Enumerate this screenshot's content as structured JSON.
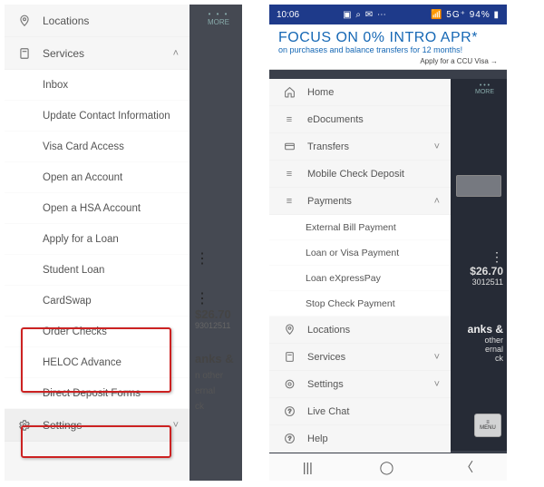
{
  "left": {
    "more_label": "MORE",
    "locations": "Locations",
    "services": "Services",
    "settings": "Settings",
    "services_items": {
      "inbox": "Inbox",
      "update_contact": "Update Contact Information",
      "visa_access": "Visa Card Access",
      "open_account": "Open an Account",
      "open_hsa": "Open a HSA Account",
      "apply_loan": "Apply for a Loan",
      "student_loan": "Student Loan",
      "cardswap": "CardSwap",
      "order_checks": "Order Checks",
      "heloc": "HELOC Advance",
      "direct_deposit": "Direct Deposit Forms"
    },
    "behind": {
      "amount": "$26.70",
      "subid": "93012511",
      "section_title": "anks &",
      "line1": "n other",
      "line2": "ernal",
      "line3": "ck"
    }
  },
  "right": {
    "status": {
      "time": "10:06",
      "left_icons": "▣ ⌕ ✉ ⋯",
      "right_icons": "📶 5G⁺ 94% ▮"
    },
    "banner": {
      "line1": "FOCUS ON 0% INTRO APR*",
      "line2": "on purchases and balance transfers for 12 months!",
      "line3": "Apply for a CCU Visa →"
    },
    "more_label": "MORE",
    "menu": {
      "home": "Home",
      "edocs": "eDocuments",
      "transfers": "Transfers",
      "mobile_deposit": "Mobile Check Deposit",
      "payments": "Payments",
      "payments_items": {
        "ext_bill": "External Bill Payment",
        "loan_visa": "Loan or Visa Payment",
        "loan_express": "Loan eXpressPay",
        "stop_check": "Stop Check Payment"
      },
      "locations": "Locations",
      "services": "Services",
      "settings": "Settings",
      "live_chat": "Live Chat",
      "help": "Help"
    },
    "behind": {
      "amount": "$26.70",
      "subid": "3012511",
      "section_title": "anks &",
      "line1": "other",
      "line2": "ernal",
      "line3": "ck",
      "menu_btn": "MENU"
    }
  }
}
